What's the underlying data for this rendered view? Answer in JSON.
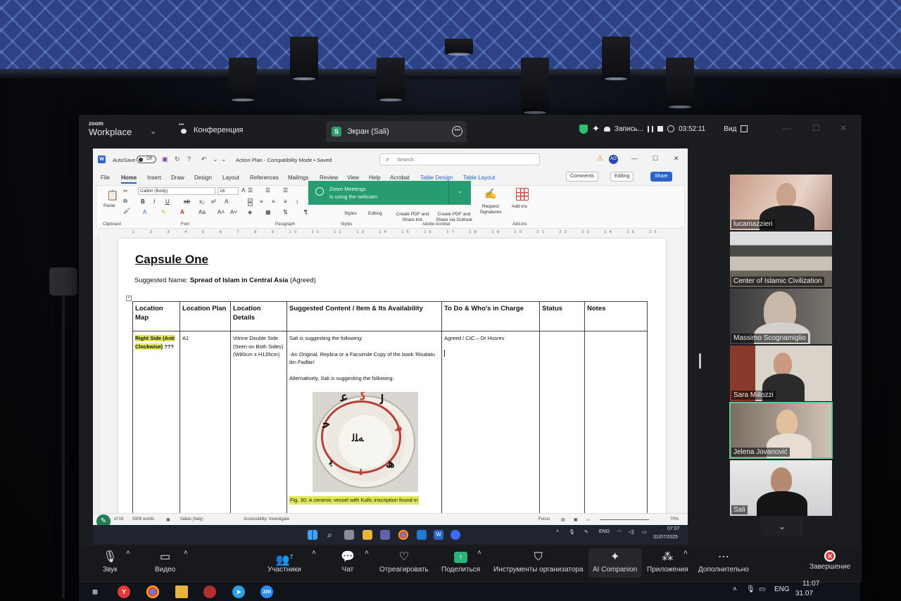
{
  "zoom": {
    "logo_top": "zoom",
    "logo_bottom": "Workplace",
    "meeting_menu": "Конференция",
    "share_tab": "Экран (Sali)",
    "share_tab_initial": "S",
    "recording": "Запись...",
    "timer": "03:52:11",
    "view": "Вид"
  },
  "word": {
    "autosave": "AutoSave",
    "toggle": "Off",
    "doc_title": "Action Plan  -  Compatibility Mode  •  Saved",
    "search_placeholder": "Search",
    "avatar": "AO",
    "menu": [
      "File",
      "Home",
      "Insert",
      "Draw",
      "Design",
      "Layout",
      "References",
      "Mailings",
      "Review",
      "View",
      "Help",
      "Acrobat",
      "Table Design",
      "Table Layout"
    ],
    "comments": "Comments",
    "editing": "Editing",
    "share": "Share",
    "font_name": "Calibri (Body)",
    "font_size": "16",
    "ribbon_groups": [
      "Clipboard",
      "Font",
      "Paragraph",
      "Styles",
      "Adobe Acrobat",
      "Add-ins"
    ],
    "ribbon_labels": {
      "paste": "Paste",
      "styles": "Styles",
      "editing": "Editing",
      "create_pdf": "Create PDF and Share link",
      "create_pdf_outlook": "Create PDF and Share via Outlook",
      "request_sig": "Request Signatures",
      "add_ins": "Add-ins"
    },
    "toast_line1": "Zoom Meetings",
    "toast_line2": "is using the webcam",
    "ruler": "1 · 2 · 3 · 4 · 5 · 6 · 7 · 8 · 9 · 10 · 11 · 12 · 13 · 14 · 15 · 16 · 17 · 18 · 19 · 20 · 21 · 22 · 23 · 24 · 25 · 26 · 27 · 28 · 29 · 30 · 31 · 32 · 33 · 34 · 35 · 36 · 37 · 38 · 39 · 40 · 41 · 42",
    "status_words": "3309 words",
    "status_lang": "Italian (Italy)",
    "status_access": "Accessibility: Investigate",
    "status_focus": "Focus",
    "status_zoom": "70%",
    "status_page": "of 19"
  },
  "doc": {
    "heading": "Capsule One",
    "suggested_label": "Suggested Name: ",
    "suggested_name": "Spread of Islam in Central Asia",
    "suggested_suffix": " (Agreed)",
    "headers": [
      "Location Map",
      "Location Plan",
      "Location Details",
      "Suggested Content / Item & Its Availability",
      "To Do & Who's in Charge",
      "Status",
      "Notes"
    ],
    "row": {
      "map": "Right Side (Anti Clockwise)",
      "map_suffix": " ???",
      "plan": "A1",
      "details": "Vitrine Double Side (Seen on Both Sides) (W80cm x H135cm)",
      "content_p1": "Sali is suggesting the following:",
      "content_p2": "-An Original, Replica or a Facsimile Copy of the book 'Risalatu ibn Fadlan'",
      "content_p3": "Alternatively, Sali is suggesting the following:",
      "caption": "Fig. 30: A ceramic vessel with Kufic inscription found in",
      "todo": "Agreed / CIC – Dr Husrev",
      "status": "",
      "notes": ""
    }
  },
  "shared_taskbar": {
    "lang": "ENG",
    "time": "07:07",
    "date": "31/07/2025"
  },
  "participants": [
    {
      "name": "lucamazzieri"
    },
    {
      "name": "Center of Islamic Civilization"
    },
    {
      "name": "Massimo Scognamiglio"
    },
    {
      "name": "Sara Millozzi"
    },
    {
      "name": "Jelena Jovanović"
    },
    {
      "name": "Sali"
    }
  ],
  "toolbar": {
    "audio": "Звук",
    "video": "Видео",
    "participants": "Участники",
    "participants_count": "7",
    "chat": "Чат",
    "react": "Отреагировать",
    "share": "Поделиться",
    "host_tools": "Инструменты организатора",
    "ai": "AI Companion",
    "apps": "Приложения",
    "more": "Дополнительно",
    "end": "Завершение"
  },
  "host_taskbar": {
    "lang": "ENG",
    "time": "11:07",
    "date": "31.07"
  },
  "colors": {
    "zoom_green": "#2bb37b",
    "word_blue": "#2b64c6",
    "highlight": "#e3ea5a",
    "end_red": "#e03b3b"
  }
}
